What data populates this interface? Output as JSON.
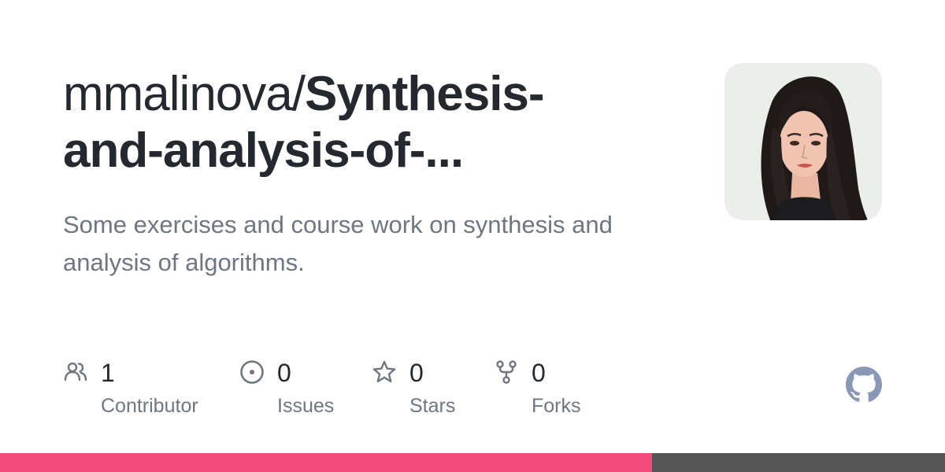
{
  "repo": {
    "owner": "mmalinova/",
    "name_line1": "Synthesis-",
    "name_line2": "and-analysis-of-...",
    "description": "Some exercises and course work on synthesis and analysis of algorithms."
  },
  "avatar": {
    "alt": "mmalinova avatar"
  },
  "stats": [
    {
      "icon": "people-icon",
      "value": "1",
      "label": "Contributor"
    },
    {
      "icon": "issue-icon",
      "value": "0",
      "label": "Issues"
    },
    {
      "icon": "star-icon",
      "value": "0",
      "label": "Stars"
    },
    {
      "icon": "fork-icon",
      "value": "0",
      "label": "Forks"
    }
  ],
  "logo": {
    "icon": "github-logo-icon",
    "color": "#8b98b5"
  },
  "languages": [
    {
      "share": 0.69,
      "color": "#f1497b"
    },
    {
      "share": 0.31,
      "color": "#555555"
    }
  ],
  "colors": {
    "title": "#24292f",
    "muted": "#6e7781",
    "icon": "#6e7781"
  }
}
